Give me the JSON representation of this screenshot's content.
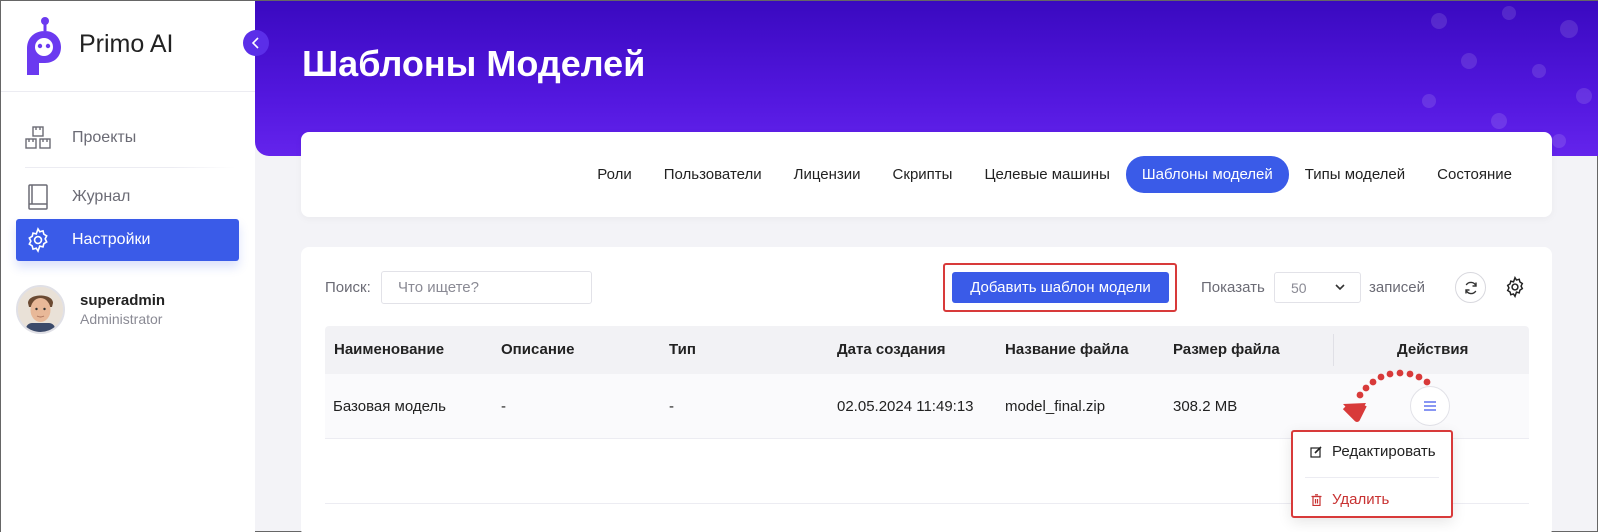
{
  "brand": {
    "name": "Primo AI"
  },
  "sidebar": {
    "items": [
      {
        "label": "Проекты",
        "icon": "boxes-icon",
        "active": false
      },
      {
        "label": "Журнал",
        "icon": "book-icon",
        "active": false
      },
      {
        "label": "Настройки",
        "icon": "gear-icon",
        "active": true
      }
    ],
    "user": {
      "name": "superadmin",
      "role": "Administrator"
    }
  },
  "header": {
    "title": "Шаблоны Моделей"
  },
  "tabs": [
    {
      "label": "Роли",
      "active": false
    },
    {
      "label": "Пользователи",
      "active": false
    },
    {
      "label": "Лицензии",
      "active": false
    },
    {
      "label": "Скрипты",
      "active": false
    },
    {
      "label": "Целевые машины",
      "active": false
    },
    {
      "label": "Шаблоны моделей",
      "active": true
    },
    {
      "label": "Типы моделей",
      "active": false
    },
    {
      "label": "Состояние",
      "active": false
    }
  ],
  "toolbar": {
    "search_label": "Поиск:",
    "search_placeholder": "Что ищете?",
    "add_label": "Добавить шаблон модели",
    "show_label": "Показать",
    "page_size": "50",
    "records_label": "записей"
  },
  "table": {
    "columns": [
      "Наименование",
      "Описание",
      "Тип",
      "Дата создания",
      "Название файла",
      "Размер файла",
      "Действия"
    ],
    "rows": [
      [
        "Базовая модель",
        "-",
        "-",
        "02.05.2024 11:49:13",
        "model_final.zip",
        "308.2 MB"
      ]
    ]
  },
  "row_menu": {
    "edit_label": "Редактировать",
    "delete_label": "Удалить"
  },
  "colors": {
    "accent": "#3a5be8",
    "header_gradient_start": "#3a09c0",
    "header_gradient_end": "#6424ec",
    "annotation_red": "#d83a3a",
    "danger": "#c83232"
  }
}
